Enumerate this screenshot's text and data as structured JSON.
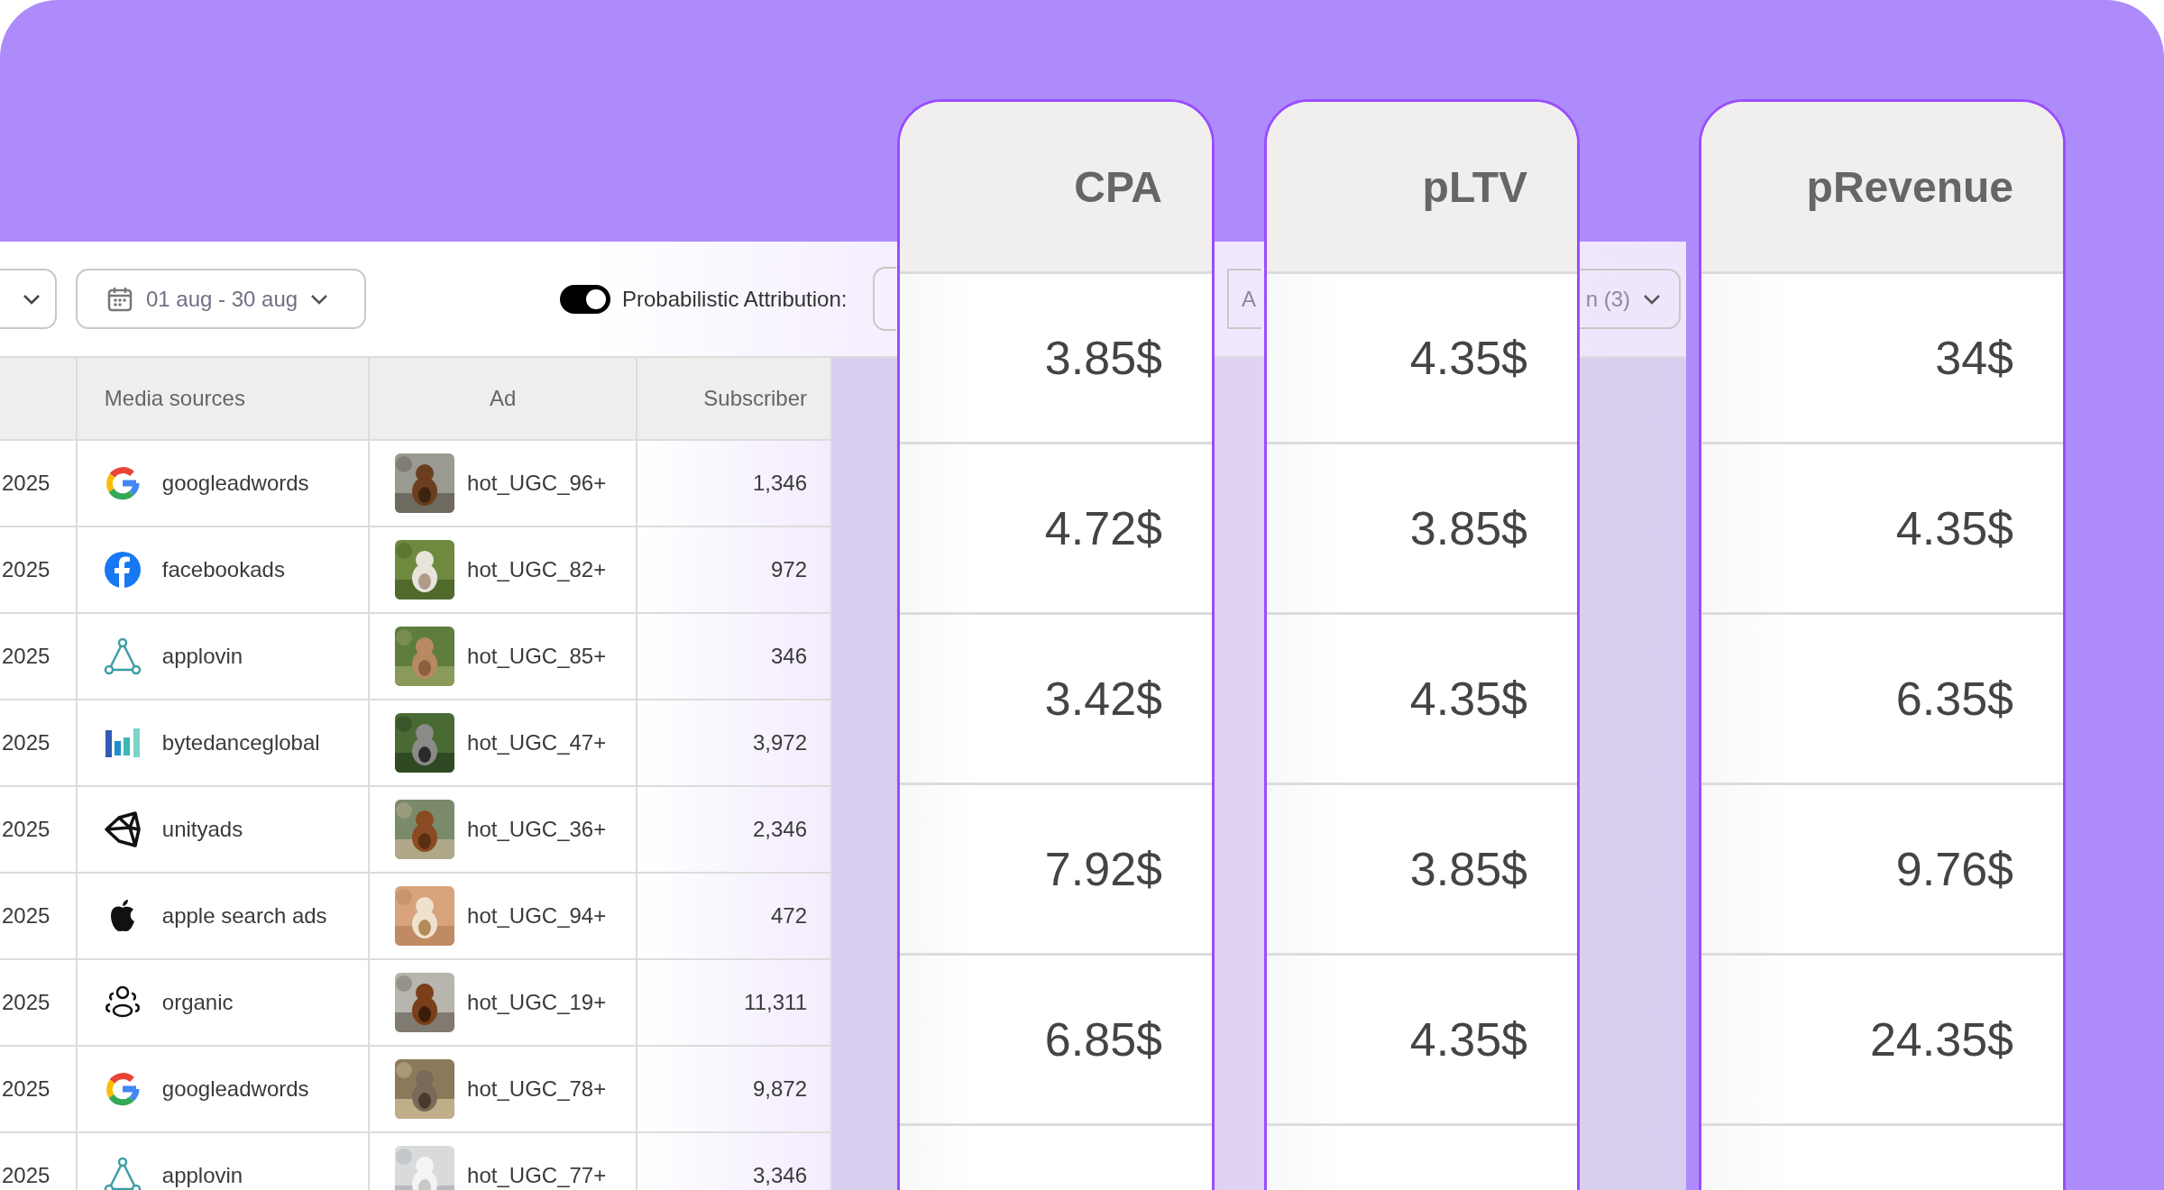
{
  "filters": {
    "date_range": "01 aug - 30 aug",
    "attribution_label": "Probabilistic Attribution:",
    "attribution_on": true,
    "field_fragment": "A",
    "columns_button": "n (3)"
  },
  "table": {
    "columns": [
      "Media sources",
      "Ad",
      "Subscriber"
    ],
    "rows": [
      {
        "date": "2025",
        "source": "googleadwords",
        "kind": "google",
        "ad": "hot_UGC_96+",
        "subscriber": "1,346"
      },
      {
        "date": "2025",
        "source": "facebookads",
        "kind": "facebook",
        "ad": "hot_UGC_82+",
        "subscriber": "972"
      },
      {
        "date": "2025",
        "source": "applovin",
        "kind": "applovin",
        "ad": "hot_UGC_85+",
        "subscriber": "346"
      },
      {
        "date": "2025",
        "source": "bytedanceglobal",
        "kind": "bytedance",
        "ad": "hot_UGC_47+",
        "subscriber": "3,972"
      },
      {
        "date": "2025",
        "source": "unityads",
        "kind": "unity",
        "ad": "hot_UGC_36+",
        "subscriber": "2,346"
      },
      {
        "date": "2025",
        "source": "apple search ads",
        "kind": "apple",
        "ad": "hot_UGC_94+",
        "subscriber": "472"
      },
      {
        "date": "2025",
        "source": "organic",
        "kind": "organic",
        "ad": "hot_UGC_19+",
        "subscriber": "11,311"
      },
      {
        "date": "2025",
        "source": "googleadwords",
        "kind": "google",
        "ad": "hot_UGC_78+",
        "subscriber": "9,872"
      },
      {
        "date": "2025",
        "source": "applovin",
        "kind": "applovin",
        "ad": "hot_UGC_77+",
        "subscriber": "3,346"
      }
    ]
  },
  "metric_cards": [
    {
      "title": "CPA",
      "values": [
        "3.85$",
        "4.72$",
        "3.42$",
        "7.92$",
        "6.85$"
      ]
    },
    {
      "title": "pLTV",
      "values": [
        "4.35$",
        "3.85$",
        "4.35$",
        "3.85$",
        "4.35$"
      ]
    },
    {
      "title": "pRevenue",
      "values": [
        "34$",
        "4.35$",
        "6.35$",
        "9.76$",
        "24.35$"
      ]
    }
  ]
}
